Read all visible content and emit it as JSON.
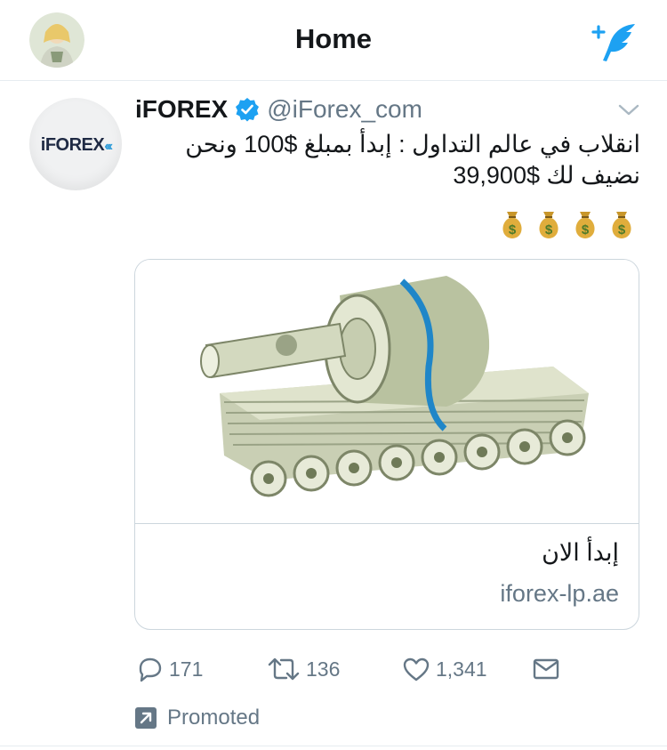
{
  "header": {
    "title": "Home"
  },
  "tweet": {
    "display_name": "iFOREX",
    "handle": "@iForex_com",
    "avatar_logo_text": "iFOREX",
    "text_line1": "انقلاب في عالم التداول : إبدأ بمبلغ $100 ونحن",
    "text_line2": "نضيف لك $39,900",
    "emoji": [
      "money-bag",
      "money-bag",
      "money-bag",
      "money-bag"
    ],
    "card": {
      "title": "إبدأ الان",
      "domain": "iforex-lp.ae",
      "image": "money-tank"
    },
    "actions": {
      "replies": "171",
      "retweets": "136",
      "likes": "1,341"
    },
    "promoted_label": "Promoted"
  },
  "colors": {
    "accent": "#1da1f2",
    "muted": "#657786",
    "border": "#ccd6dd"
  }
}
